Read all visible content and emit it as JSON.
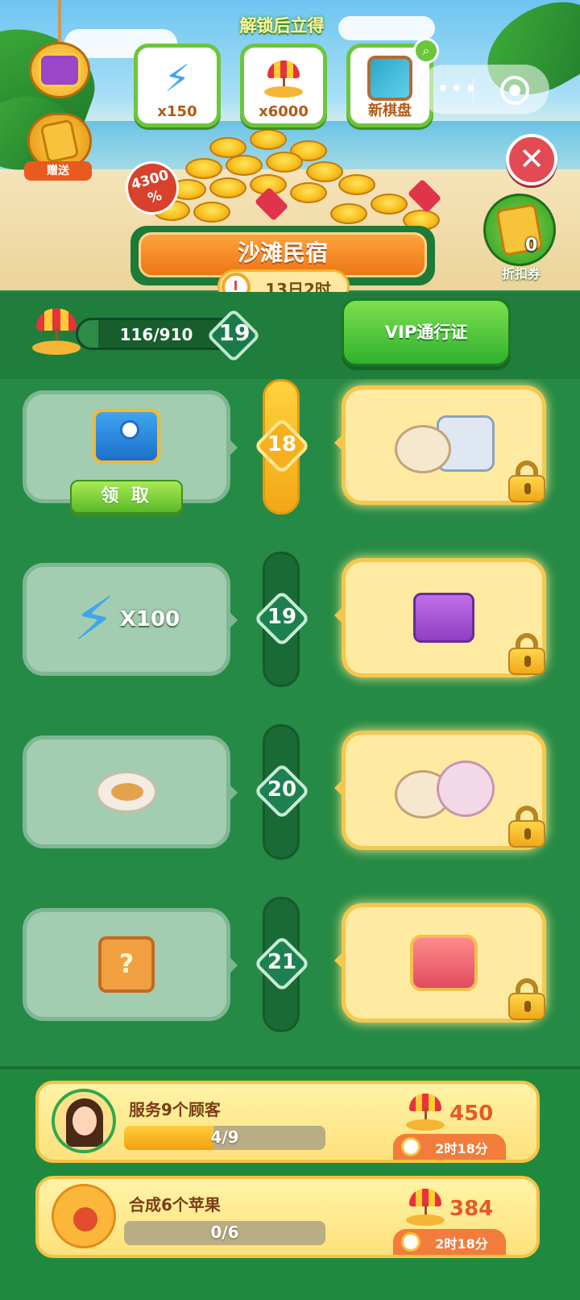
{
  "header": {
    "unlock_title": "解锁后立得",
    "gift_label": "赠送",
    "rewards": [
      {
        "icon": "energy-bolt-icon",
        "label": "x150"
      },
      {
        "icon": "beach-umbrella-icon",
        "label": "x6000"
      },
      {
        "icon": "board-icon",
        "label": "新棋盘"
      }
    ],
    "discount": {
      "value": "4300",
      "unit": "%"
    },
    "coupon": {
      "count": "0",
      "label": "折扣券"
    },
    "event_title": "沙滩民宿",
    "timer": "13日2时"
  },
  "progress": {
    "text": "116/910",
    "fraction": 0.127,
    "level": "19",
    "vip_button": "VIP通行证"
  },
  "tiers": [
    {
      "level": "18",
      "active": true,
      "free_reward": "blue-chest",
      "free_label": "",
      "claim_label": "领 取",
      "vip_reward": "food-set"
    },
    {
      "level": "19",
      "active": false,
      "free_reward": "energy-bolt",
      "free_label": "X100",
      "claim_label": "",
      "vip_reward": "purple-chest"
    },
    {
      "level": "20",
      "active": false,
      "free_reward": "food-plate",
      "free_label": "",
      "claim_label": "",
      "vip_reward": "dessert-set"
    },
    {
      "level": "21",
      "active": false,
      "free_reward": "mystery-box",
      "free_label": "",
      "claim_label": "",
      "vip_reward": "red-chest"
    }
  ],
  "tasks": [
    {
      "label": "服务9个顾客",
      "progress_text": "4/9",
      "fraction": 0.444,
      "reward": "450",
      "timer": "2时18分",
      "icon": "customer-avatar"
    },
    {
      "label": "合成6个苹果",
      "progress_text": "0/6",
      "fraction": 0,
      "reward": "384",
      "timer": "2时18分",
      "icon": "apple"
    }
  ],
  "colors": {
    "accent": "#2a8a4a",
    "gold": "#f6b01e",
    "vip_card": "#ffeaa2"
  }
}
